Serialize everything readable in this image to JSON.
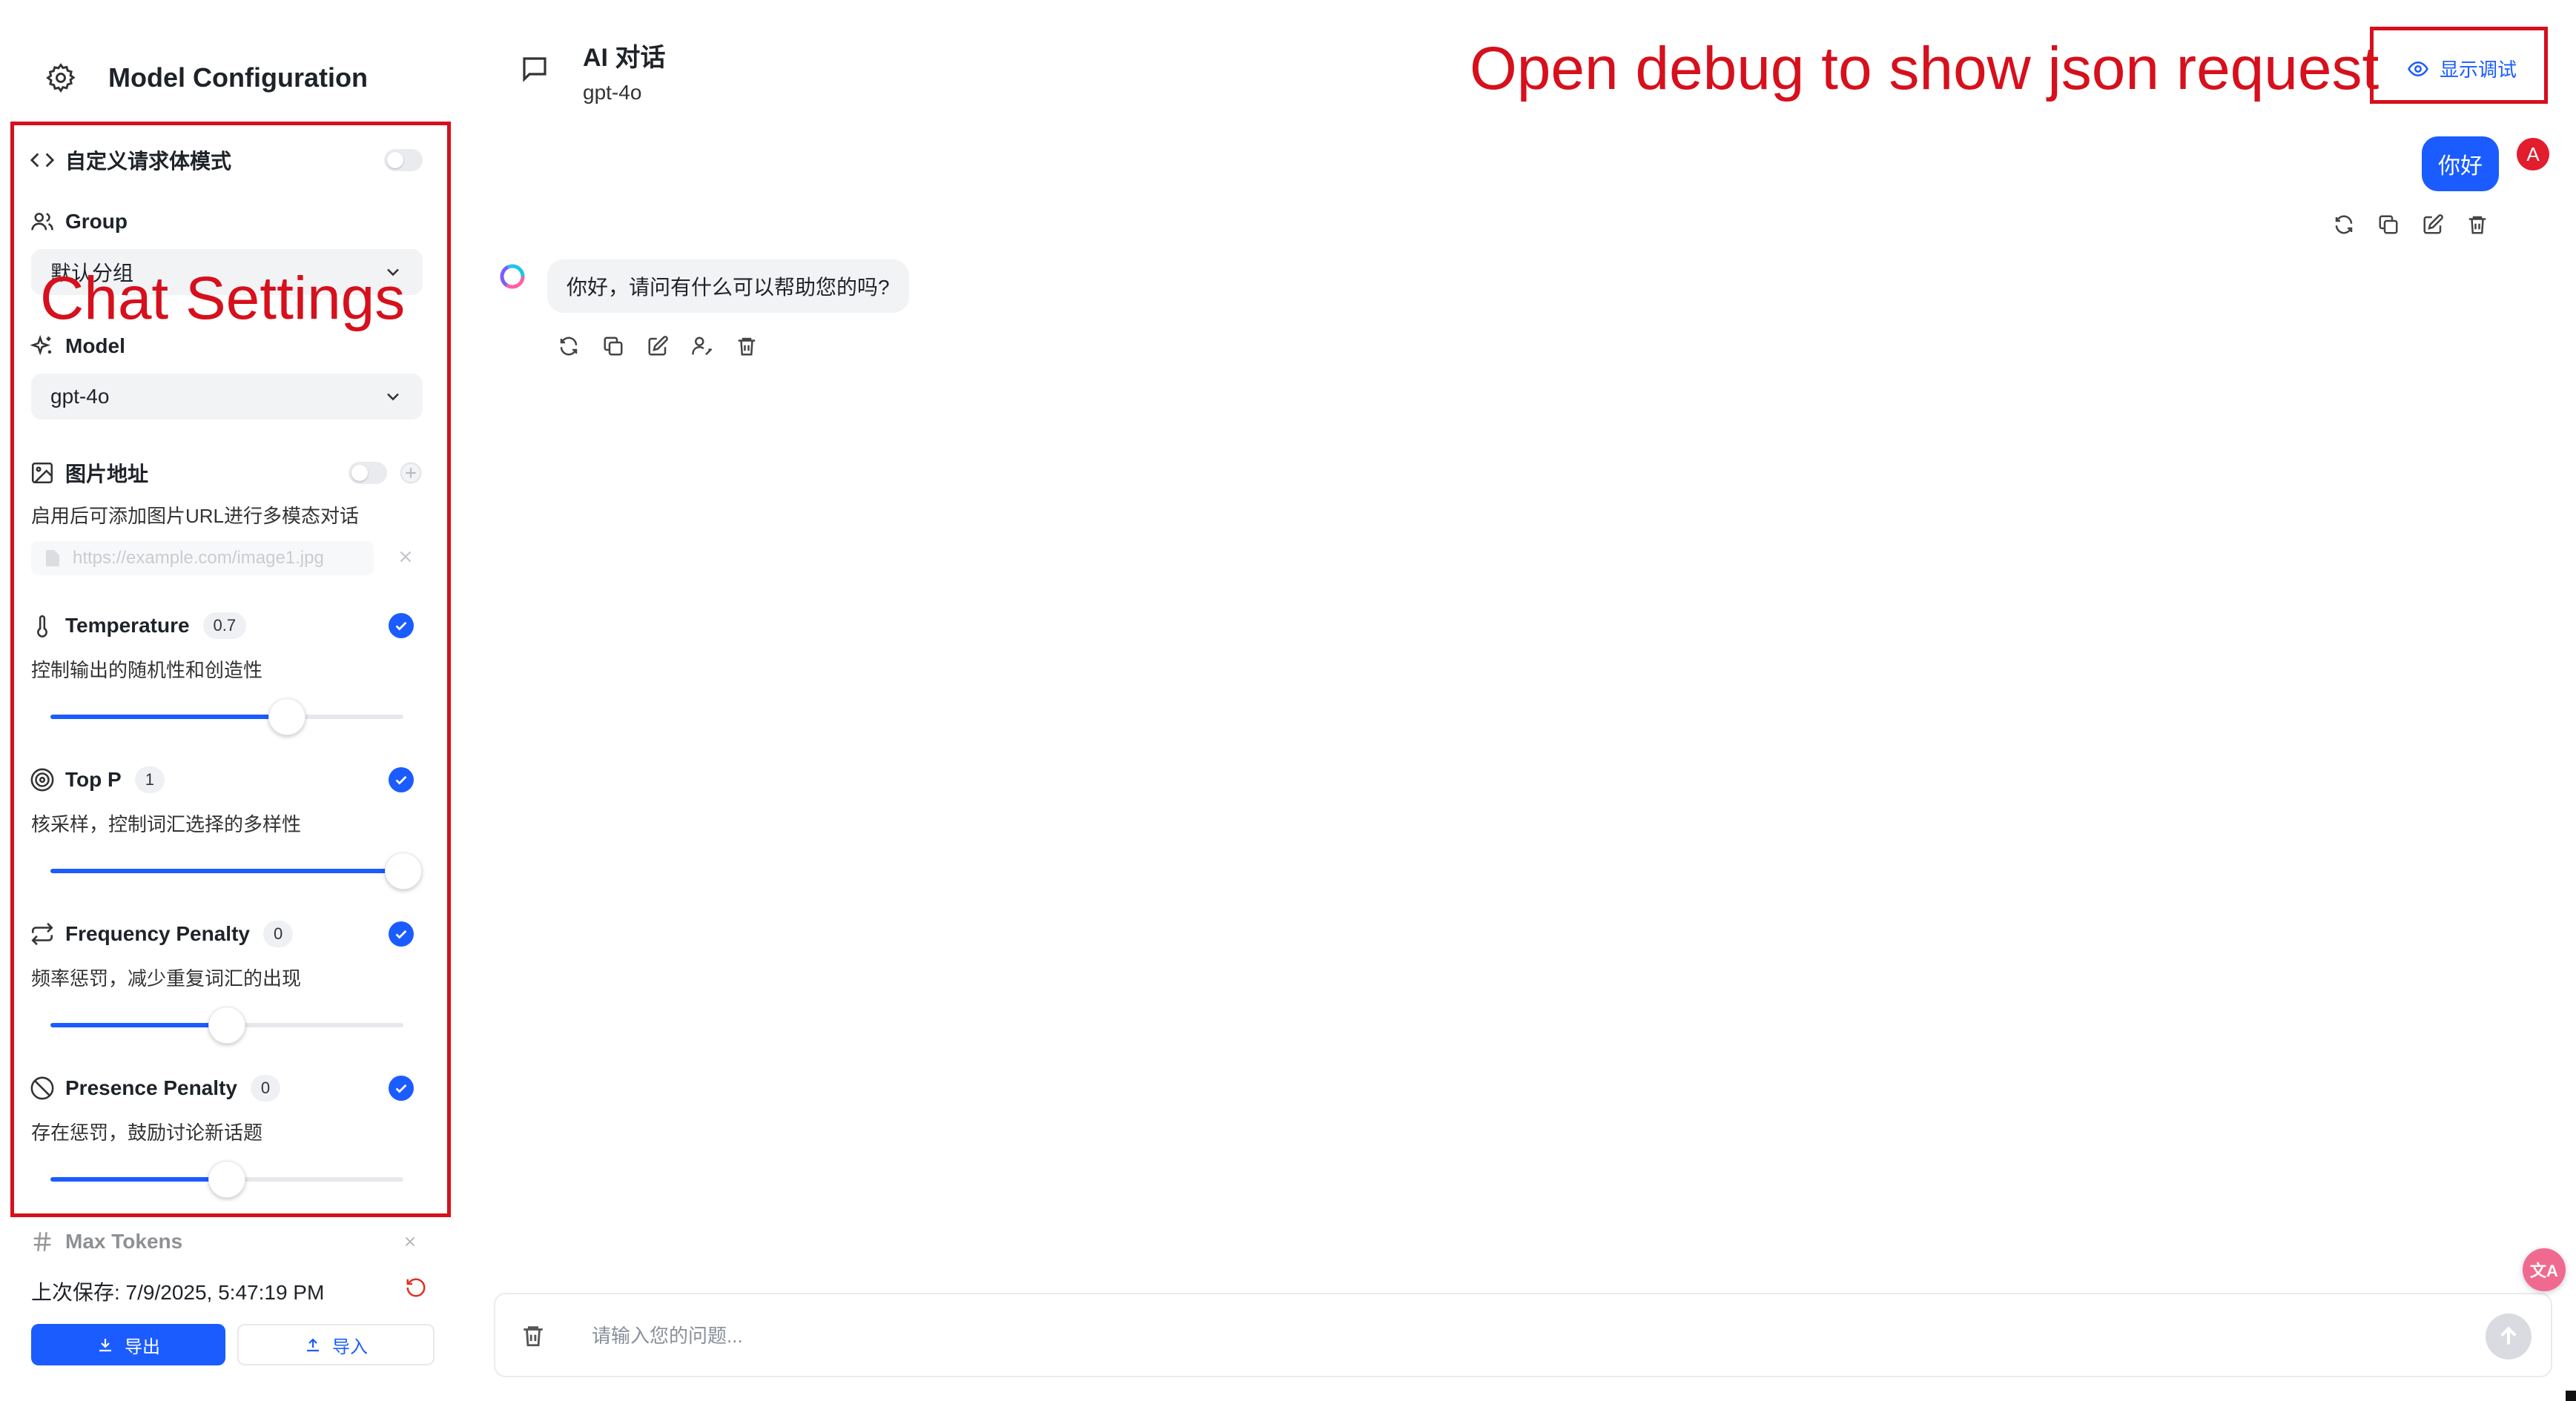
{
  "sidebar": {
    "title": "Model Configuration",
    "custom_mode_label": "自定义请求体模式",
    "group": {
      "label": "Group",
      "value": "默认分组"
    },
    "model": {
      "label": "Model",
      "value": "gpt-4o"
    },
    "image_url": {
      "label": "图片地址",
      "description": "启用后可添加图片URL进行多模态对话",
      "placeholder": "https://example.com/image1.jpg"
    },
    "params": [
      {
        "label": "Temperature",
        "value": "0.7",
        "description": "控制输出的随机性和创造性",
        "enabled": true,
        "level": 0.67
      },
      {
        "label": "Top P",
        "value": "1",
        "description": "核采样，控制词汇选择的多样性",
        "enabled": true,
        "level": 1.0
      },
      {
        "label": "Frequency Penalty",
        "value": "0",
        "description": "频率惩罚，减少重复词汇的出现",
        "enabled": true,
        "level": 0.5
      },
      {
        "label": "Presence Penalty",
        "value": "0",
        "description": "存在惩罚，鼓励讨论新话题",
        "enabled": true,
        "level": 0.5
      }
    ],
    "max_tokens_label": "Max Tokens",
    "last_saved": "上次保存: 7/9/2025, 5:47:19 PM",
    "export_label": "导出",
    "import_label": "导入"
  },
  "chat": {
    "title": "AI 对话",
    "model": "gpt-4o",
    "debug_button": "显示调试",
    "messages": [
      {
        "role": "user",
        "text": "你好",
        "avatar": "A"
      },
      {
        "role": "assistant",
        "text": "你好，请问有什么可以帮助您的吗?"
      }
    ],
    "input_placeholder": "请输入您的问题..."
  },
  "annotations": {
    "settings": "Chat Settings",
    "debug": "Open debug to show json request",
    "color": "#d6101c"
  },
  "colors": {
    "accent": "#1a5cff",
    "avatar": "#e11d2e"
  },
  "icons": {
    "translate_fab": "文A"
  }
}
